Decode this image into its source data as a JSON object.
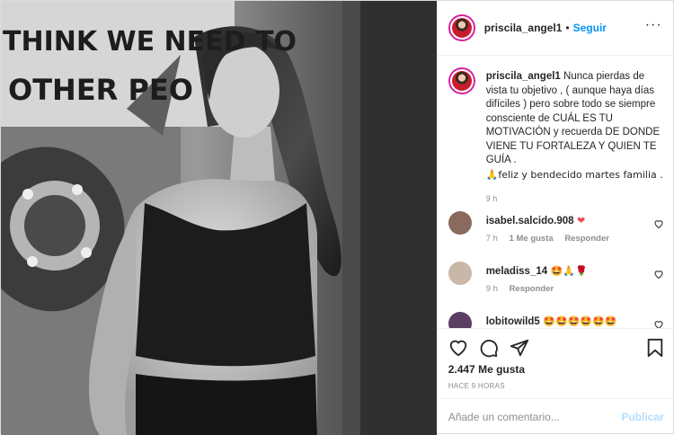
{
  "post": {
    "username": "priscila_angel1",
    "separator": "•",
    "follow_label": "Seguir",
    "more_icon": "more-options-icon",
    "mural_text": {
      "line1": "THINK WE NEED TO",
      "line2": "OTHER PEO"
    },
    "caption": {
      "username": "priscila_angel1",
      "text": " Nunca pierdas de vista tu objetivo , ( aunque haya días difíciles ) pero sobre todo se siempre consciente de CUÁL ES TU MOTIVACIÓN y recuerda DE DONDE VIENE TU FORTALEZA Y QUIEN TE GUÍA .",
      "text2": "🙏feliz y bendecido martes familia .",
      "time": "9 h"
    },
    "comments": [
      {
        "username": "isabel.salcido.908",
        "text": " ❤",
        "time": "7 h",
        "likes": "1 Me gusta",
        "reply": "Responder",
        "avatar_color": "#8a6a5c"
      },
      {
        "username": "meladiss_14",
        "text": " 🤩🙏🌹",
        "time": "9 h",
        "likes": "",
        "reply": "Responder",
        "avatar_color": "#c9b7a8"
      },
      {
        "username": "lobitowild5",
        "text": " 🤩🤩🤩🤩🤩🤩",
        "time": "",
        "likes": "",
        "reply": "",
        "avatar_color": "#5a3f63"
      }
    ],
    "likes_count": "2.447 Me gusta",
    "time_ago": "HACE 9 HORAS",
    "add_comment_placeholder": "Añade un comentario...",
    "publish_label": "Publicar",
    "colors": {
      "accent_blue": "#0095f6",
      "publish_disabled": "#b2dffc",
      "heart_red": "#ed4956",
      "muted_text": "#8e8e8e"
    }
  }
}
